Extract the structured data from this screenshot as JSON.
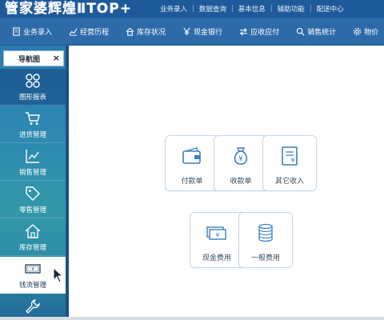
{
  "titlebar": {
    "app_title": "管家婆辉煌ⅡTOP+",
    "menu": [
      "业务录入",
      "数据查询",
      "基本信息",
      "辅助功能",
      "配送中心"
    ],
    "separator": "|"
  },
  "toolbar": {
    "items": [
      {
        "label": "业务录入",
        "icon": "doc-icon"
      },
      {
        "label": "经营历程",
        "icon": "trend-icon"
      },
      {
        "label": "库存状况",
        "icon": "home-icon"
      },
      {
        "label": "现金银行",
        "icon": "yen-icon"
      },
      {
        "label": "应收应付",
        "icon": "arrows-icon"
      },
      {
        "label": "销售统计",
        "icon": "search-icon"
      },
      {
        "label": "物价",
        "icon": "gear-icon"
      }
    ]
  },
  "sidebar": {
    "tab_label": "导航图",
    "close_symbol": "×",
    "items": [
      {
        "label": "图形报表",
        "icon": "grid-clover-icon"
      },
      {
        "label": "进货管理",
        "icon": "cart-icon"
      },
      {
        "label": "销售管理",
        "icon": "line-chart-icon"
      },
      {
        "label": "零售管理",
        "icon": "tag-icon"
      },
      {
        "label": "库存管理",
        "icon": "house-icon"
      },
      {
        "label": "钱流管理",
        "icon": "banknote-icon"
      },
      {
        "label": "",
        "icon": "wrench-icon"
      }
    ],
    "active_index": 5
  },
  "main": {
    "cards": [
      {
        "label": "付款单",
        "icon": "wallet-icon"
      },
      {
        "label": "收款单",
        "icon": "money-bag-icon"
      },
      {
        "label": "其它收入",
        "icon": "ledger-yen-icon"
      },
      {
        "label": "现金费用",
        "icon": "cash-stack-icon"
      },
      {
        "label": "一般费用",
        "icon": "coin-stack-icon"
      }
    ]
  },
  "colors": {
    "titlebar": "#1e5a9a",
    "toolbar": "#2d6aa8",
    "icon_blue": "#3a7fc4",
    "sidebar": "#2e8ab1"
  }
}
